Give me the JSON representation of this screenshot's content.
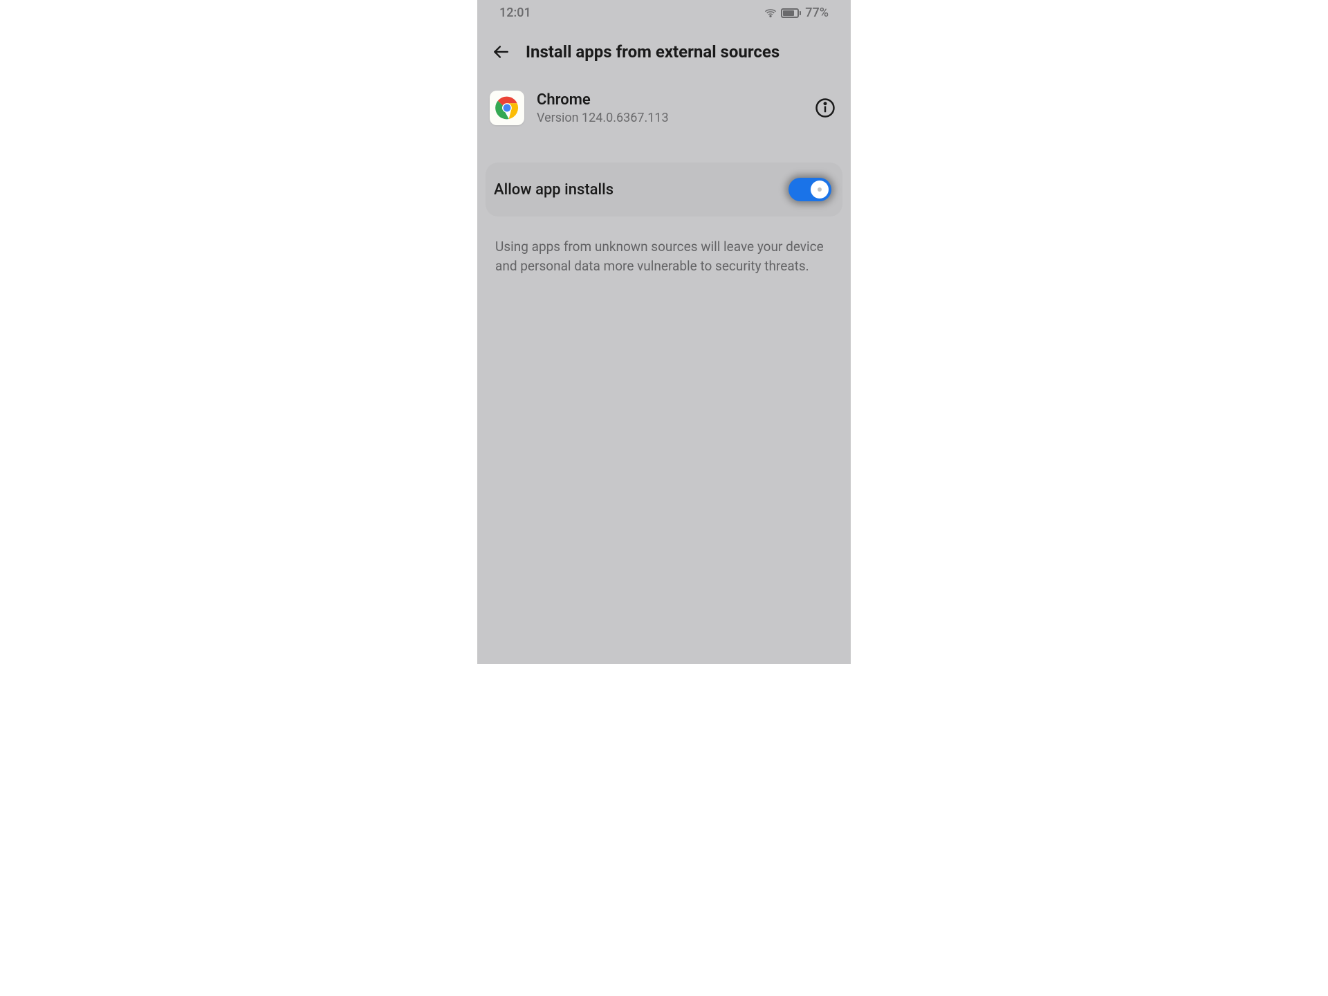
{
  "status_bar": {
    "time": "12:01",
    "battery_percent": "77%"
  },
  "header": {
    "title": "Install apps from external sources"
  },
  "app": {
    "name": "Chrome",
    "version": "Version 124.0.6367.113"
  },
  "setting": {
    "label": "Allow app installs",
    "enabled": true
  },
  "warning": "Using apps from unknown sources will leave your device and personal data more vulnerable to security threats."
}
